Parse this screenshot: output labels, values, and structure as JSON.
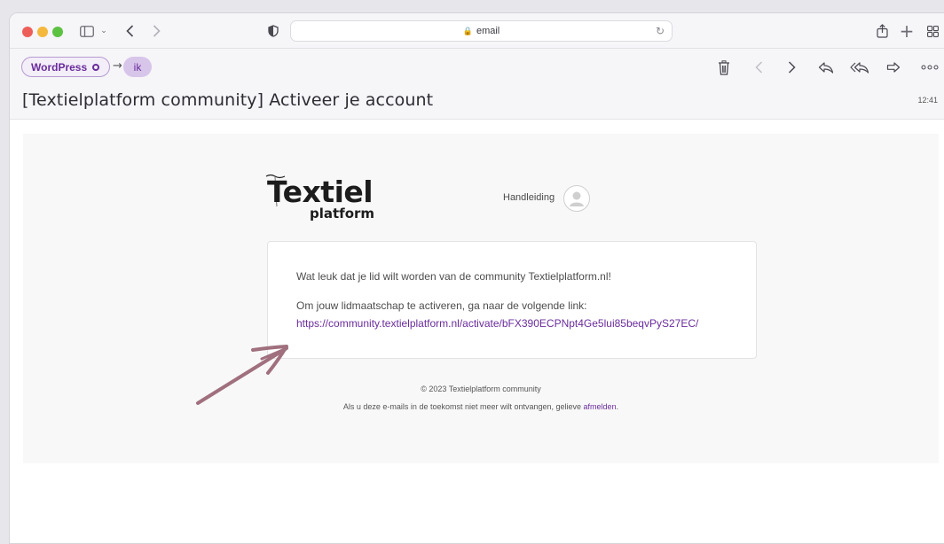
{
  "browser": {
    "url": "email",
    "icons": {
      "sidebar": "sidebar-icon",
      "chevron": "chevron-down-icon",
      "back": "back-arrow-icon",
      "forward": "forward-arrow-icon",
      "shield": "shield-icon",
      "share": "share-icon",
      "new_tab": "plus-icon",
      "tabs": "tab-overview-icon"
    }
  },
  "mail": {
    "from_chip": "WordPress",
    "to_chip": "ik",
    "subject": "[Textielplatform community] Activeer je account",
    "time": "12:41",
    "actions": [
      "trash-icon",
      "previous-icon",
      "next-icon",
      "reply-icon",
      "reply-all-icon",
      "forward-icon",
      "more-icon"
    ]
  },
  "email": {
    "logo_big": "Textiel",
    "logo_small": "platform",
    "handleiding": "Handleiding",
    "intro": "Wat leuk dat je lid wilt worden van de community Textielplatform.nl!",
    "instruction": "Om jouw lidmaatschap te activeren, ga naar de volgende link:",
    "activation_link": "https://community.textielplatform.nl/activate/bFX390ECPNpt4Ge5lui85beqvPyS27EC/",
    "copyright": "© 2023 Textielplatform community",
    "unsubscribe_text": "Als u deze e-mails in de toekomst niet meer wilt ontvangen, gelieve ",
    "unsubscribe_link": "afmelden",
    "unsubscribe_suffix": "."
  },
  "colors": {
    "accent_purple": "#6a2c9c",
    "annotation_arrow": "#a0707e"
  }
}
